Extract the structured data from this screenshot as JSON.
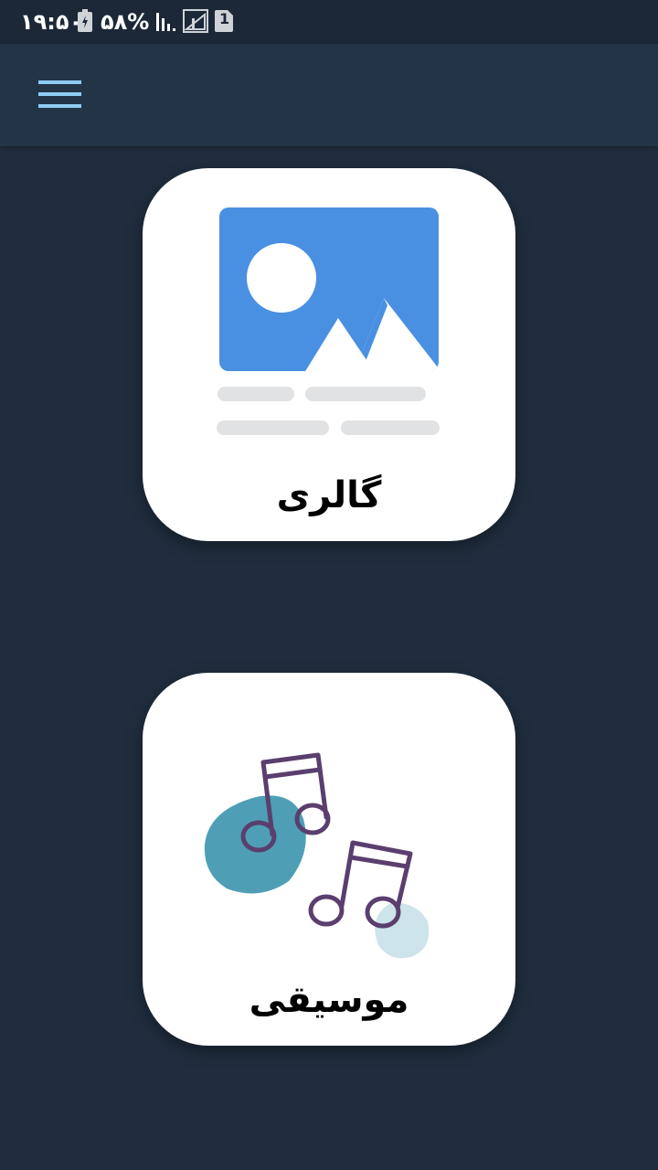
{
  "status_bar": {
    "time": "۱۹:۵۰",
    "battery_percent": "۵۸%",
    "sim_badge": "1",
    "icons": [
      "battery-charging-icon",
      "signal-icon",
      "no-signal-icon",
      "sim-icon"
    ]
  },
  "app_bar": {
    "menu_icon": "hamburger-menu-icon",
    "accent_color": "#8ecdf5"
  },
  "cards": [
    {
      "label": "گالری",
      "icon": "gallery-image-icon",
      "colors": {
        "image_bg": "#4a90e2",
        "placeholder": "#e1e2e4"
      }
    },
    {
      "label": "موسیقی",
      "icon": "music-notes-icon",
      "colors": {
        "note_stroke": "#5a3f6e",
        "blob_dark": "#4e9fb6",
        "blob_light": "#cde4ea"
      }
    }
  ],
  "colors": {
    "background": "#1f2d3e",
    "app_bar": "#243447",
    "status_bar": "#1c2838",
    "card": "#ffffff"
  }
}
